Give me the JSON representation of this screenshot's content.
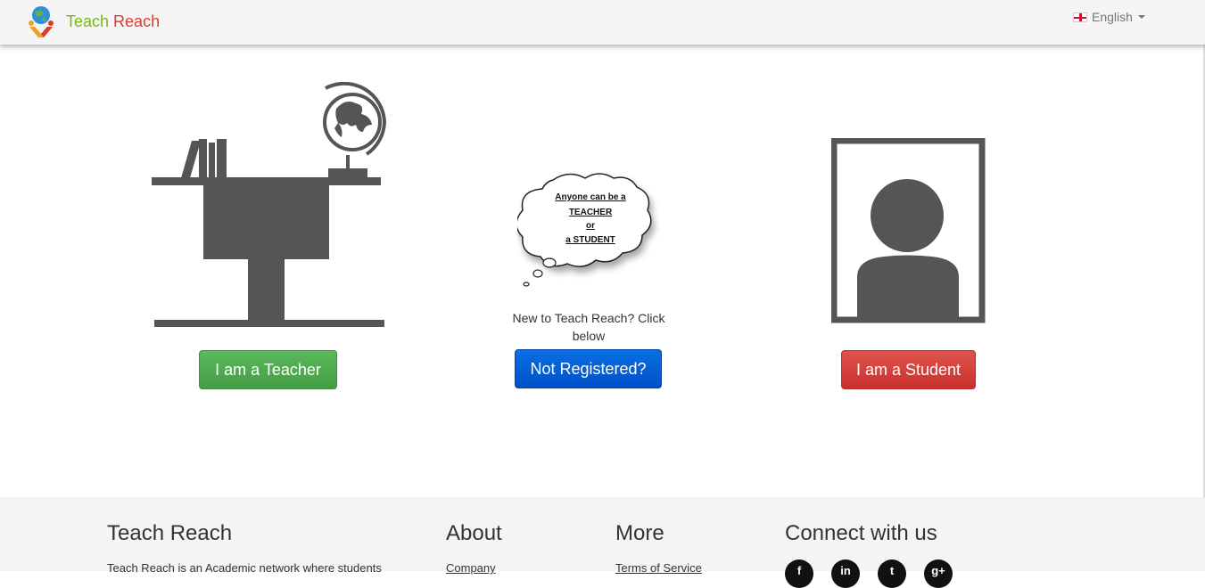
{
  "navbar": {
    "brand_part1": "Teach",
    "brand_part2": " Reach",
    "language": "English"
  },
  "teacher": {
    "button_label": "I am a Teacher"
  },
  "bubble": {
    "line1": "Anyone can be a",
    "line2": "TEACHER",
    "line3": "or",
    "line4": "a STUDENT"
  },
  "register": {
    "prompt": "New to Teach Reach? Click below",
    "button_label": "Not Registered?"
  },
  "student": {
    "button_label": "I am a Student"
  },
  "footer": {
    "col1": {
      "heading": "Teach Reach",
      "text": "Teach Reach is an Academic network where students"
    },
    "col2": {
      "heading": "About",
      "link": "Company"
    },
    "col3": {
      "heading": "More",
      "link": "Terms of Service"
    },
    "col4": {
      "heading": "Connect with us",
      "social": [
        "f",
        "in",
        "t",
        "g+"
      ]
    }
  },
  "colors": {
    "brand_green": "#7cb518",
    "brand_red": "#e03a2f",
    "teacher_green": "#5cb85c",
    "register_blue": "#0a6fe3",
    "student_red": "#d9534f",
    "illustration_gray": "#555555"
  }
}
